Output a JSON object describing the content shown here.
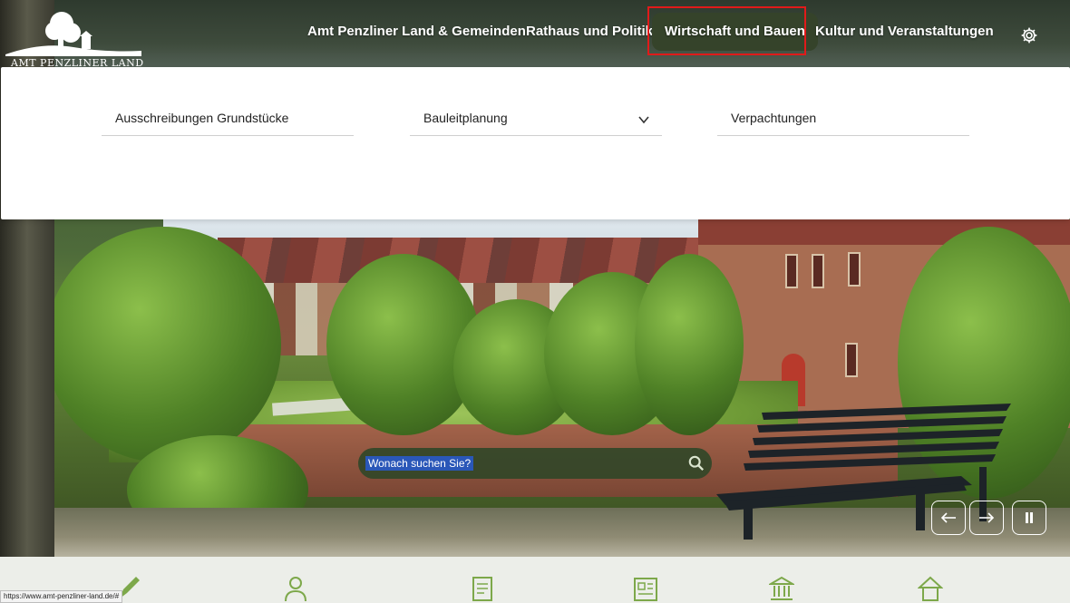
{
  "logo": {
    "text": "AMT PENZLINER LAND"
  },
  "nav": {
    "items": [
      {
        "label": "Amt Penzliner Land & Gemeinden"
      },
      {
        "label": "Rathaus und Politik"
      },
      {
        "label": "Wirtschaft und Bauen"
      },
      {
        "label": "Kultur und Veranstaltungen"
      }
    ],
    "active": "Wirtschaft und Bauen",
    "settings_icon": "gear-icon"
  },
  "submenu": {
    "items": [
      {
        "label": "Ausschreibungen Grundstücke"
      },
      {
        "label": "Bauleitplanung",
        "has_dropdown": true
      },
      {
        "label": "Verpachtungen"
      }
    ]
  },
  "search": {
    "placeholder": "Wonach suchen Sie?",
    "icon": "search-icon"
  },
  "slider": {
    "prev_icon": "arrow-left-icon",
    "next_icon": "arrow-right-icon",
    "pause_icon": "pause-icon"
  },
  "bottom_icons": [
    "pencil-icon",
    "person-icon",
    "document-icon",
    "newspaper-icon",
    "townhall-icon",
    "house-icon"
  ],
  "status_bar": {
    "url": "https://www.amt-penzliner-land.de/#"
  },
  "colors": {
    "accent": "#35432a",
    "focus": "#e11a1a",
    "panel": "#ffffff"
  }
}
